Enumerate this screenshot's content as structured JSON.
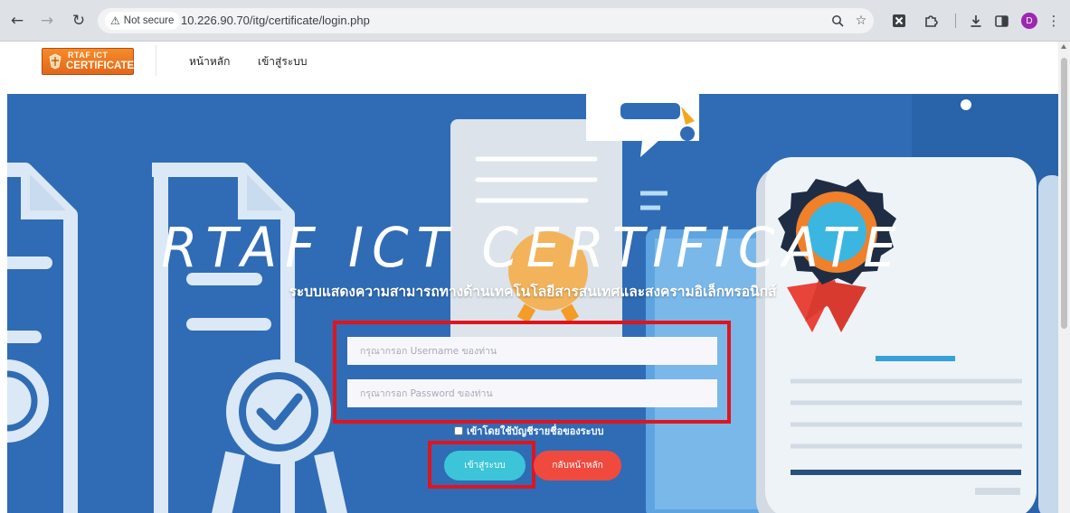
{
  "browser": {
    "security_label": "Not secure",
    "url": "10.226.90.70/itg/certificate/login.php",
    "profile_initial": "D",
    "icons": [
      "back-arrow-icon",
      "forward-arrow-icon",
      "reload-icon",
      "warning-icon",
      "zoom-icon",
      "star-icon",
      "extension-x-icon",
      "extensions-puzzle-icon",
      "download-icon",
      "sidebar-icon",
      "menu-dots-icon"
    ]
  },
  "site": {
    "logo_line1": "RTAF ICT",
    "logo_line2": "CERTIFICATE",
    "nav": [
      "หน้าหลัก",
      "เข้าสู่ระบบ"
    ]
  },
  "hero": {
    "title": "RTAF ICT CERTIFICATE",
    "subtitle": "ระบบแสดงความสามารถทางด้านเทคโนโลยีสารสนเทศและสงครามอิเล็กทรอนิกส์",
    "username_placeholder": "กรุณากรอก Username ของท่าน",
    "password_placeholder": "กรุณากรอก Password ของท่าน",
    "remember_label": "เข้าโดยใช้บัญชีรายชื่อของระบบ",
    "login_button": "เข้าสู่ระบบ",
    "back_button": "กลับหน้าหลัก"
  },
  "colors": {
    "hero_bg": "#2f6cb5",
    "login_button": "#3cc4d8",
    "back_button": "#f04a3e",
    "highlight_box": "#e0141e",
    "logo": "#f0802a"
  }
}
